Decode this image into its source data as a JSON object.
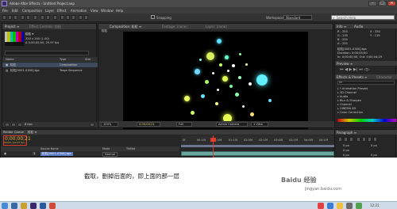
{
  "window": {
    "title": "Adobe After Effects - Untitled Project.aep"
  },
  "menu": [
    "File",
    "Edit",
    "Composition",
    "Layer",
    "Effect",
    "Animation",
    "View",
    "Window",
    "Help"
  ],
  "toolbar": {
    "snapping": "Snapping",
    "workspace_label": "Workspace:",
    "workspace_value": "Standard",
    "search_placeholder": "Search Help"
  },
  "project": {
    "tab": "Project ≡",
    "tab2": "Effect Controls: 粒粒",
    "name": "粒粒 ▾",
    "info1": "320 x 240 (1.00)",
    "info2": "Δ 0;00;05;00, 29.97 fps",
    "columns": {
      "name": "Name",
      "type": "Type",
      "size": "Size"
    },
    "rows": [
      {
        "name": "粒粒",
        "type": "Composition"
      },
      {
        "name": "粒粒[0001-0300].tga",
        "type": "Targa Sequence"
      }
    ],
    "bit_depth": "8 bpc"
  },
  "composition": {
    "tab": "Composition: 粒粒 ≡",
    "footage_tab": "Footage: (none)",
    "layer_tab": "Layer: (none)",
    "crumb": "粒粒",
    "zoom": "100%",
    "time": "0;00;00;21",
    "resolution": "Full",
    "camera": "Active Camera",
    "view": "1 View"
  },
  "info_panel": {
    "tab": "Info ≡",
    "audio": "Audio",
    "r": "R : 255",
    "g": "G : 255",
    "b": "B : 255",
    "a": "A : 255",
    "x": "X : 250",
    "y": "Y : 119",
    "file": "粒粒[0001-0300].tga",
    "duration": "Duration: 0;00;05;00",
    "inout": "In: 0;00;00;00, Out: 0;00;04;29"
  },
  "preview_panel": {
    "tab": "Preview ≡"
  },
  "effects_panel": {
    "tab": "Effects & Presets ≡",
    "tab2": "Character",
    "search_placeholder": "ρ▾",
    "items": [
      "* Animation Presets",
      "3D Channel",
      "Audio",
      "Blur & Sharpen",
      "Channel",
      "CINEMA 4D",
      "Color Correction"
    ]
  },
  "paragraph_panel": {
    "tab": "Paragraph ≡",
    "indent": "0 px"
  },
  "timeline": {
    "tab_render": "Render Queue",
    "tab_comp": "粒粒 ≡",
    "timecode": "0;00;00;21",
    "timecode_sub": "00021 (29.97 fps)",
    "columns": {
      "source": "Source Name",
      "mode": "Mode",
      "trkmat": "TrkMat"
    },
    "layers": [
      {
        "num": "1",
        "name": "粒粒[0001-0300].tga",
        "mode": "Normal"
      },
      {
        "num": "2",
        "name": "粒粒[0001-0300].tga",
        "mode": "Normal"
      }
    ],
    "ruler_marks": [
      "0f",
      "00:15f",
      "01:00f",
      "01:15f",
      "02:00f",
      "02:15f",
      "03:00f",
      "03:15f",
      "04:00f",
      "04:15f"
    ],
    "toggle": "Toggle Switches / Modes"
  },
  "caption": "截取，删掉后面的，即上面的那一层",
  "watermark": "Baidu 经验",
  "watermark_url": "jingyan.baidu.com",
  "clock": "12:21"
}
